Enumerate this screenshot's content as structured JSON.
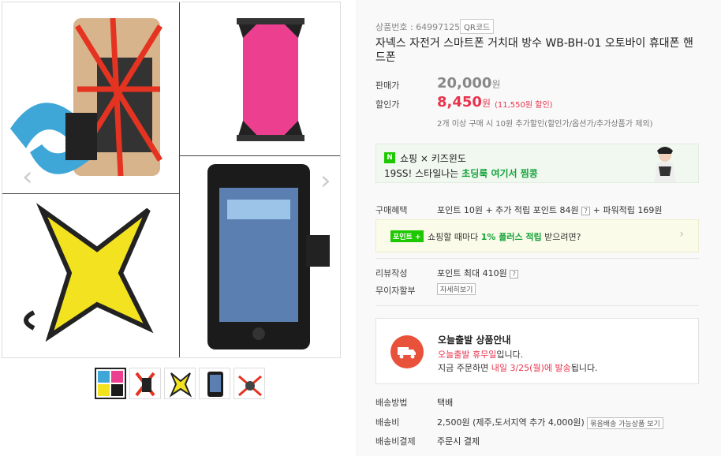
{
  "product": {
    "number_label": "상품번호 : 649971258",
    "qr_label": "QR코드",
    "title": "자넥스 자전거 스마트폰 거치대 방수 WB-BH-01 오토바이 휴대폰 핸드폰"
  },
  "price": {
    "sale_label": "판매가",
    "original": "20,000",
    "discount_label": "할인가",
    "discounted": "8,450",
    "won": "원",
    "discount_amount": "(11,550원 할인)",
    "bulk_note": "2개 이상 구매 시 10원 추가할인(할인가/옵션가/추가상품가 제외)"
  },
  "banner": {
    "logo": "N",
    "line1": "쇼핑 × 키즈윈도",
    "line2_prefix": "19SS! 스타일나는 ",
    "line2_highlight": "초딩룩 여기서 찜콩"
  },
  "benefits": {
    "label": "구매혜택",
    "text1": "포인트 10원 + 추가 적립 포인트 84원",
    "text2": "+ 파워적립 169원",
    "q": "?"
  },
  "point_box": {
    "tag": "포인트 +",
    "text_prefix": "쇼핑할 때마다 ",
    "text_highlight": "1% 플러스 적립",
    "text_suffix": " 받으려면?",
    "chevron": "›"
  },
  "review": {
    "label": "리뷰작성",
    "text": "포인트 최대 410원"
  },
  "installment": {
    "label": "무이자할부",
    "button": "자세히보기"
  },
  "shipping_notice": {
    "title": "오늘출발 상품안내",
    "line1_highlight": "오늘출발 휴무일",
    "line1_suffix": "입니다.",
    "line2_prefix": "지금 주문하면 ",
    "line2_highlight": "내일 3/25(월)에 발송",
    "line2_suffix": "됩니다."
  },
  "delivery": {
    "method_label": "배송방법",
    "method": "택배",
    "fee_label": "배송비",
    "fee": "2,500원 (제주,도서지역 추가 4,000원)",
    "bundle_button": "묶음배송 가능상품 보기",
    "pay_label": "배송비결제",
    "pay": "주문시 결제"
  },
  "colors": {
    "accent_red": "#e8344e",
    "naver_green": "#1ec800",
    "truck_red": "#e8513a"
  }
}
